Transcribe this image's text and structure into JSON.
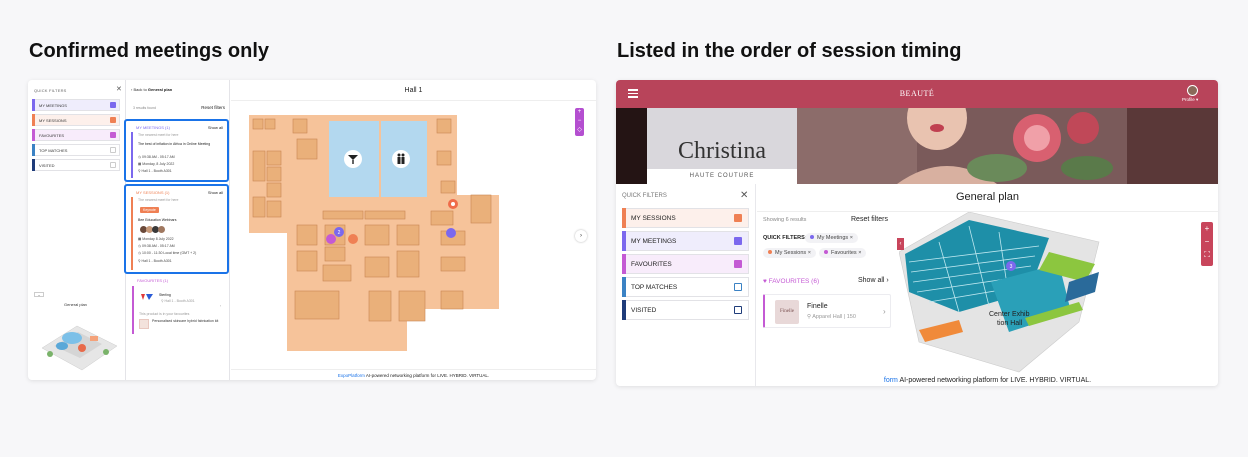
{
  "headings": {
    "left": "Confirmed meetings only",
    "right": "Listed in the order of session timing"
  },
  "left_screen": {
    "quick_filters_title": "QUICK FILTERS",
    "filters": [
      {
        "label": "MY MEETINGS",
        "color": "#7b68ee",
        "checked": true
      },
      {
        "label": "MY SESSIONS",
        "color": "#ef8054",
        "checked": true
      },
      {
        "label": "FAVOURITES",
        "color": "#c45ad4",
        "checked": true
      },
      {
        "label": "TOP MATCHES",
        "color": "#3b82c4",
        "checked": false
      },
      {
        "label": "VISITED",
        "color": "#1f3c7a",
        "checked": false
      }
    ],
    "general_plan_label": "General plan",
    "back_prefix": "Back to",
    "back_link": "General plan",
    "results": "3 results found",
    "reset": "Reset filters",
    "meetings": {
      "title": "MY MEETINGS (1)",
      "show_all": "Show all",
      "note": "The nearest meet for here",
      "event_title": "The best of inflation in Africa in Online Meeting",
      "time": "09:38 AM - 05:17 AM",
      "date": "Monday, 8 July 2022",
      "location": "Hall 1 - Booth A301"
    },
    "sessions": {
      "title": "MY SESSIONS (1)",
      "show_all": "Show all",
      "note": "The nearest meet for here",
      "tag": "Keynote",
      "event_title": "Bee Education Webinars",
      "date": "Monday 8 July 2022",
      "time1": "09:38 AM - 05:17 AM",
      "time2": "10:00 - 11:30 Local time (GMT + 2)",
      "location": "Hall 1 - Booth A301"
    },
    "favourites": {
      "title": "FAVOURITES (1)",
      "company": "Sterling",
      "company_location": "Hall 1 - Booth A301",
      "note": "This product is in your favourites",
      "product": "Personalised skincare hybrid fabrication kit"
    },
    "hall_title": "Hall 1",
    "footer_brand": "ExpoPlatform",
    "footer_text": "AI-powered networking platform for LIVE. HYBRID. VIRTUAL."
  },
  "right_screen": {
    "logo": "BEAUTÉ",
    "profile": "Profile",
    "banner_name": "Christina",
    "banner_sub": "HAUTE COUTURE",
    "quick_filters_title": "QUICK FILTERS",
    "filters": [
      {
        "label": "MY SESSIONS",
        "color": "#ef8054",
        "checked": true
      },
      {
        "label": "MY MEETINGS",
        "color": "#7b68ee",
        "checked": true
      },
      {
        "label": "FAVOURITES",
        "color": "#c45ad4",
        "checked": true
      },
      {
        "label": "TOP MATCHES",
        "color": "#3b82c4",
        "checked": false
      },
      {
        "label": "VISITED",
        "color": "#1f3c7a",
        "checked": false
      }
    ],
    "general_plan_title": "General plan",
    "results": "Showing 6 results",
    "reset": "Reset filters",
    "quick_filters_label": "QUICK FILTERS:",
    "chips": [
      {
        "label": "My Meetings",
        "color": "#7b68ee"
      },
      {
        "label": "My Sessions",
        "color": "#ef8054"
      },
      {
        "label": "Favourites",
        "color": "#c45ad4"
      }
    ],
    "favourites_title": "FAVOURITES (6)",
    "show_all": "Show all",
    "card_name": "Finelle",
    "card_logo": "Finelle",
    "card_location": "Apparel Hall | 150",
    "map_label1": "Center Exhib",
    "map_label2": "tion Hall",
    "footer_brand": "form",
    "footer_text": "AI-powered networking platform for LIVE. HYBRID. VIRTUAL."
  }
}
